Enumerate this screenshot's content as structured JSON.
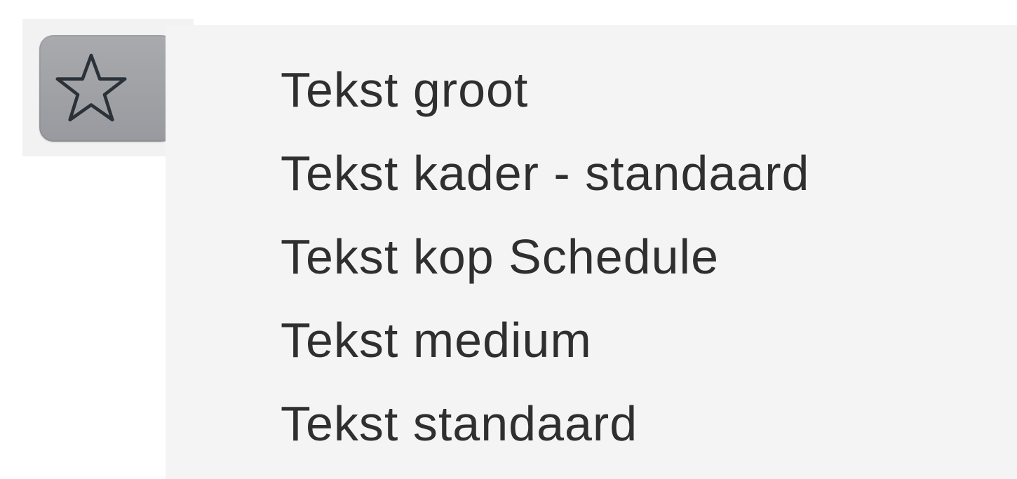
{
  "toolbar": {
    "favorites_button": {
      "icon": "star-outline-icon",
      "submenu_indicator": "chevron-right-icon",
      "color": "#9fa0a4"
    }
  },
  "menu": {
    "items": [
      {
        "label": "Tekst groot"
      },
      {
        "label": "Tekst kader - standaard"
      },
      {
        "label": "Tekst kop Schedule"
      },
      {
        "label": "Tekst medium"
      },
      {
        "label": "Tekst standaard"
      }
    ]
  },
  "colors": {
    "menu_background": "#f4f4f4",
    "text": "#2f2f2f",
    "button_background": "#9fa0a4"
  }
}
